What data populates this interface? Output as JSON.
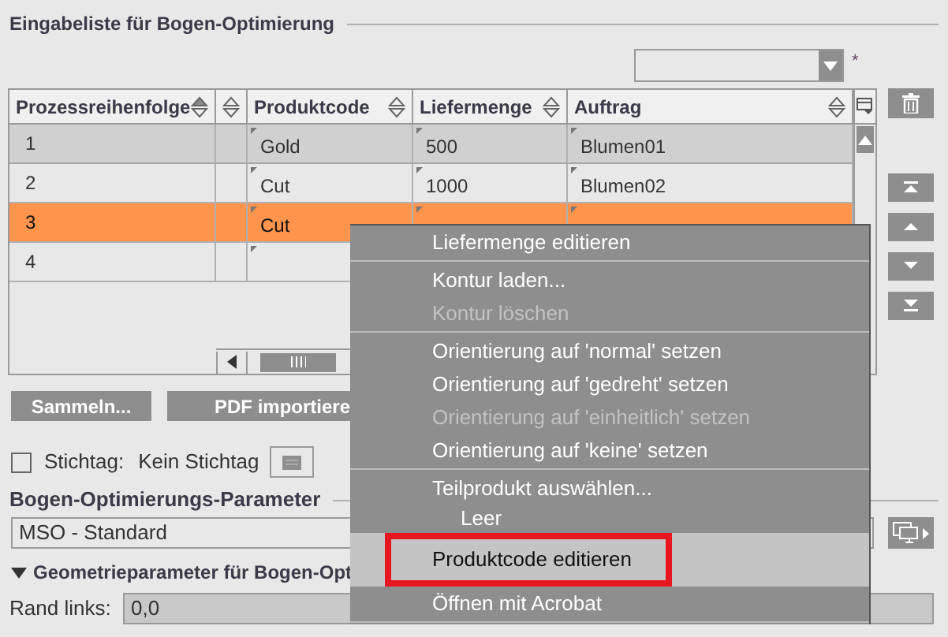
{
  "section_title": "Eingabeliste für Bogen-Optimierung",
  "filter_dropdown": {
    "required_mark": "*"
  },
  "table": {
    "columns": [
      {
        "label": "Prozessreihenfolge",
        "sorted": true
      },
      {
        "sorted": false
      },
      {
        "label": "Produktcode",
        "sorted": false
      },
      {
        "label": "Liefermenge",
        "sorted": false
      },
      {
        "label": "Auftrag",
        "sorted": false
      }
    ],
    "rows": [
      {
        "cells": [
          "1",
          null,
          "Gold",
          "500",
          "Blumen01"
        ],
        "selected": false,
        "shaded": true
      },
      {
        "cells": [
          "2",
          null,
          "Cut",
          "1000",
          "Blumen02"
        ],
        "selected": false,
        "shaded": false
      },
      {
        "cells": [
          "3",
          null,
          "Cut",
          null,
          null
        ],
        "selected": true,
        "shaded": false
      },
      {
        "cells": [
          "4",
          null,
          null,
          null,
          null
        ],
        "selected": false,
        "shaded": false
      }
    ]
  },
  "buttons": [
    "Sammeln...",
    "PDF importiere"
  ],
  "stichtag": {
    "checked": false,
    "label": "Stichtag:",
    "value": "Kein Stichtag"
  },
  "parameter_title": "Bogen-Optimierungs-Parameter",
  "parameter_value": "MSO - Standard",
  "geometry": {
    "title": "Geometrieparameter für Bogen-Opt",
    "expanded": true,
    "field_label": "Rand links:",
    "field_value": "0,0"
  },
  "context_menu": [
    {
      "kind": "item",
      "label": "Liefermenge editieren",
      "disabled": false,
      "selected": false,
      "marked": false
    },
    {
      "kind": "separator"
    },
    {
      "kind": "item",
      "label": "Kontur laden...",
      "disabled": false,
      "selected": false,
      "marked": false
    },
    {
      "kind": "item",
      "label": "Kontur löschen",
      "disabled": true,
      "selected": false,
      "marked": false
    },
    {
      "kind": "separator"
    },
    {
      "kind": "item",
      "label": "Orientierung auf 'normal' setzen",
      "disabled": false,
      "selected": false,
      "marked": false
    },
    {
      "kind": "item",
      "label": "Orientierung auf 'gedreht' setzen",
      "disabled": false,
      "selected": false,
      "marked": false
    },
    {
      "kind": "item",
      "label": "Orientierung auf 'einheitlich' setzen",
      "disabled": true,
      "selected": false,
      "marked": false
    },
    {
      "kind": "item",
      "label": "Orientierung auf 'keine' setzen",
      "disabled": false,
      "selected": false,
      "marked": false
    },
    {
      "kind": "separator"
    },
    {
      "kind": "item",
      "label": "Teilprodukt auswählen...",
      "disabled": false,
      "selected": false,
      "marked": false
    },
    {
      "kind": "subitem",
      "label": "Leer",
      "disabled": false,
      "selected": false,
      "marked": false
    },
    {
      "kind": "item",
      "label": "Produktcode editieren",
      "disabled": false,
      "selected": true,
      "marked": true
    },
    {
      "kind": "item",
      "label": "Öffnen mit Acrobat",
      "disabled": false,
      "selected": false,
      "marked": false
    },
    {
      "kind": "separator"
    }
  ]
}
